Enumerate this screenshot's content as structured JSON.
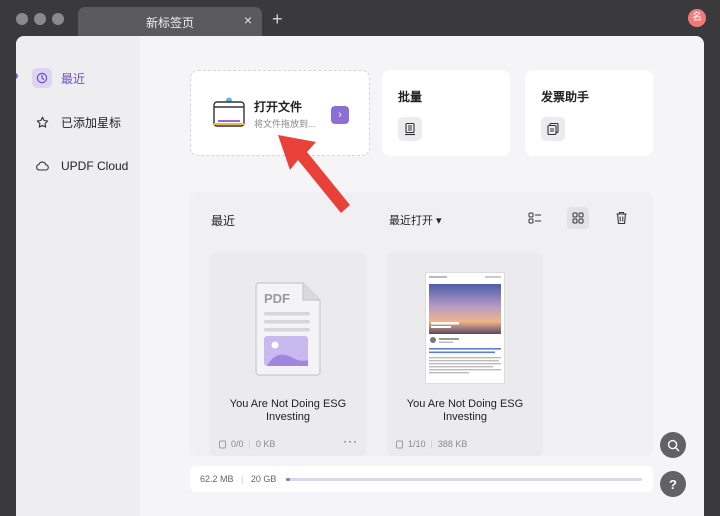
{
  "titlebar": {
    "tab_title": "新标签页",
    "tab_close": "×",
    "new_tab": "+",
    "avatar_text": "名"
  },
  "sidebar": {
    "items": [
      {
        "label": "最近",
        "icon": "clock-icon",
        "active": true
      },
      {
        "label": "已添加星标",
        "icon": "star-icon",
        "active": false
      },
      {
        "label": "UPDF Cloud",
        "icon": "cloud-icon",
        "active": false
      }
    ]
  },
  "actions": {
    "open": {
      "title": "打开文件",
      "subtitle": "将文件拖放到...",
      "go": "›"
    },
    "batch": {
      "title": "批量"
    },
    "invoice": {
      "title": "发票助手"
    }
  },
  "recent": {
    "title": "最近",
    "sort_label": "最近打开 ▾",
    "files": [
      {
        "name": "You Are Not Doing ESG Investing",
        "pages": "0/0",
        "size": "0 KB",
        "thumb": "pdf-placeholder",
        "more": "···"
      },
      {
        "name": "You Are Not Doing ESG Investing",
        "pages": "1/10",
        "size": "388 KB",
        "thumb": "document-preview",
        "more": "···"
      }
    ]
  },
  "storage": {
    "used": "62.2 MB",
    "total": "20 GB",
    "fill_fraction": 0.003
  },
  "colors": {
    "accent": "#8c6fd6",
    "accent_light": "#dcd5f2",
    "annotation_arrow": "#e8413a",
    "avatar": "#f07a78"
  }
}
